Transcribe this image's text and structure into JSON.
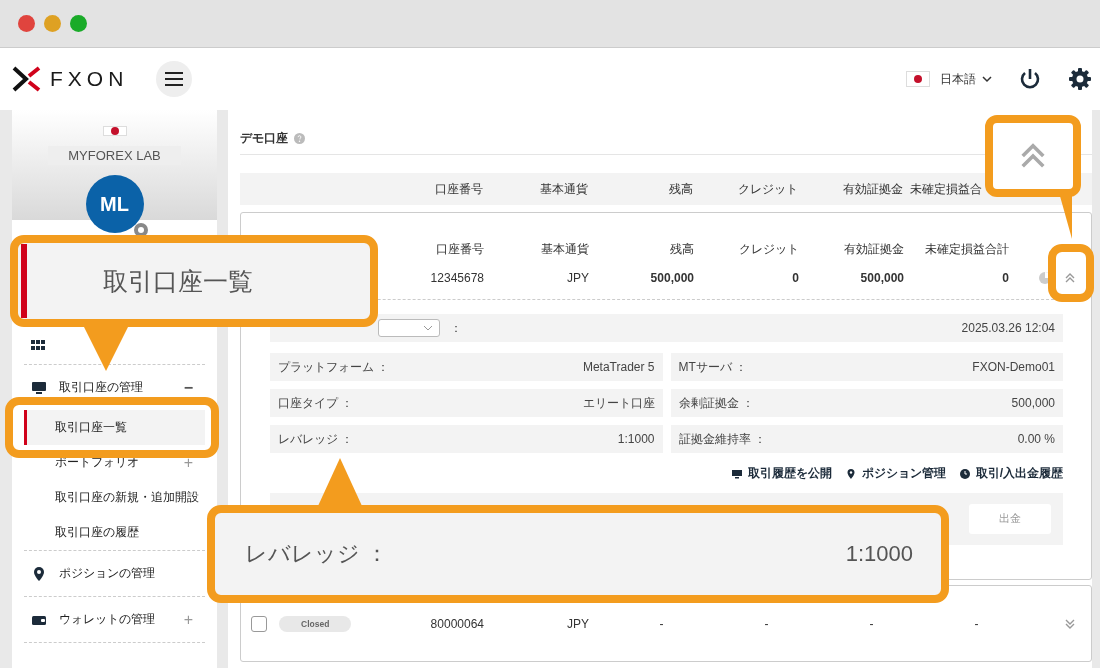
{
  "header": {
    "logo": "FXON",
    "language": "日本語"
  },
  "sidebar": {
    "profile": {
      "name": "MYFOREX LAB",
      "initials": "ML"
    },
    "menu": [
      {
        "kind": "group",
        "label": "取引口座の管理",
        "expanded": true,
        "toggle": "−",
        "children": [
          {
            "kind": "link",
            "label": "取引口座一覧",
            "selected": true
          },
          {
            "kind": "group",
            "label": "ポートフォリオ",
            "selected": false,
            "expanded": false,
            "toggle": "+"
          },
          {
            "kind": "link",
            "label": "取引口座の新規・追加開設",
            "selected": false
          },
          {
            "kind": "link",
            "label": "取引口座の履歴",
            "selected": false
          }
        ]
      },
      {
        "kind": "link",
        "label": "ポジションの管理"
      },
      {
        "kind": "group",
        "label": "ウォレットの管理",
        "expanded": false,
        "toggle": "+"
      }
    ]
  },
  "main": {
    "title": "デモ口座",
    "columns": [
      "口座番号",
      "基本通貨",
      "残高",
      "クレジット",
      "有効証拠金",
      "未確定損益合"
    ],
    "accounts": [
      {
        "expanded": true,
        "number": "12345678",
        "currency": "JPY",
        "cells": [
          "500,000",
          "0",
          "500,000",
          "0"
        ],
        "labels": [
          "口座番号",
          "基本通貨",
          "残高",
          "クレジット",
          "有効証拠金",
          "未確定損益合計"
        ],
        "date_separator": "：",
        "date": "2025.03.26 12:04",
        "details": [
          {
            "label": "プラットフォーム ：",
            "value": "MetaTrader 5"
          },
          {
            "label": "MTサーバ ：",
            "value": "FXON-Demo01"
          },
          {
            "label": "口座タイプ ：",
            "value": "エリート口座"
          },
          {
            "label": "余剰証拠金 ：",
            "value": "500,000"
          },
          {
            "label": "レバレッジ ：",
            "value": "1:1000"
          },
          {
            "label": "証拠金維持率 ：",
            "value": "0.00 %"
          }
        ],
        "links": [
          "取引履歴を公開",
          "ポジション管理",
          "取引/入出金履歴"
        ],
        "buttons": [
          "出金"
        ]
      },
      {
        "expanded": false,
        "checked": false,
        "status": "Closed",
        "number": "80000064",
        "currency": "JPY",
        "cells": [
          "-",
          "-",
          "-",
          "-"
        ]
      }
    ]
  },
  "callouts": [
    {
      "kind": "menu",
      "text": "取引口座一覧"
    },
    {
      "kind": "chevron"
    },
    {
      "kind": "detail",
      "label": "レバレッジ ：",
      "value": "1:1000"
    }
  ]
}
